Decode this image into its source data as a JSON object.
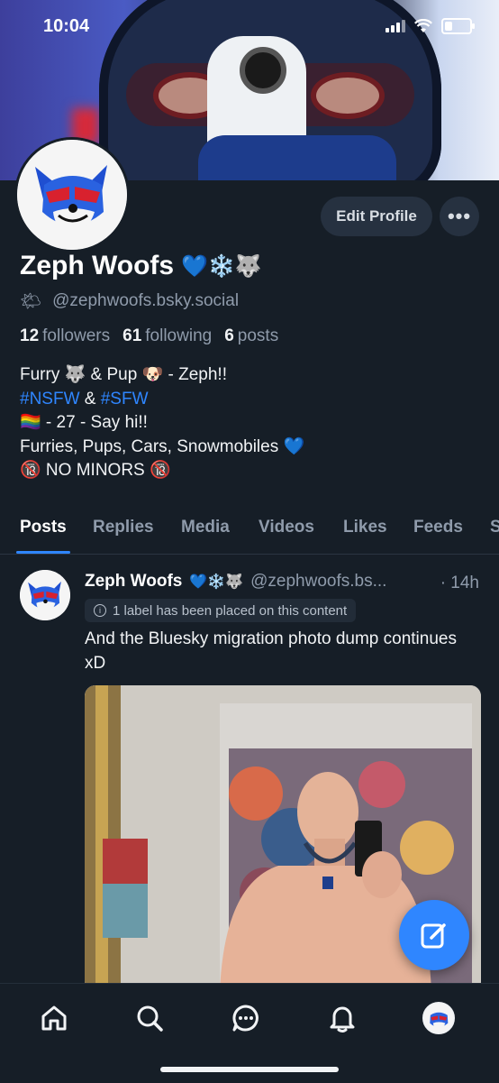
{
  "status_bar": {
    "time": "10:04"
  },
  "profile": {
    "display_name": "Zeph Woofs",
    "name_emoji": "💙❄️🐺",
    "handle_emoji": "🌤",
    "handle": "@zephwoofs.bsky.social",
    "edit_label": "Edit Profile",
    "more_label": "•••",
    "stats": {
      "followers_count": "12",
      "followers_label": "followers",
      "following_count": "61",
      "following_label": "following",
      "posts_count": "6",
      "posts_label": "posts"
    },
    "bio": {
      "line1": "Furry 🐺 & Pup 🐶 - Zeph!!",
      "tag1": "#NSFW",
      "amp": " & ",
      "tag2": "#SFW",
      "line3": "🏳️‍🌈 - 27 - Say hi!!",
      "line4": "Furries, Pups, Cars, Snowmobiles 💙",
      "line5": "🔞 NO MINORS 🔞"
    }
  },
  "tabs": [
    "Posts",
    "Replies",
    "Media",
    "Videos",
    "Likes",
    "Feeds",
    "S"
  ],
  "post": {
    "author_name": "Zeph Woofs",
    "author_emoji": "💙❄️🐺",
    "author_handle": "@zephwoofs.bs...",
    "time": "· 14h",
    "label_text": "1 label has been placed on this content",
    "text": "And the Bluesky migration photo dump continues xD"
  },
  "colors": {
    "accent": "#2f86ff",
    "background": "#161e27"
  },
  "icons": [
    "home-icon",
    "search-icon",
    "chat-icon",
    "bell-icon",
    "profile-avatar-icon",
    "compose-icon"
  ]
}
